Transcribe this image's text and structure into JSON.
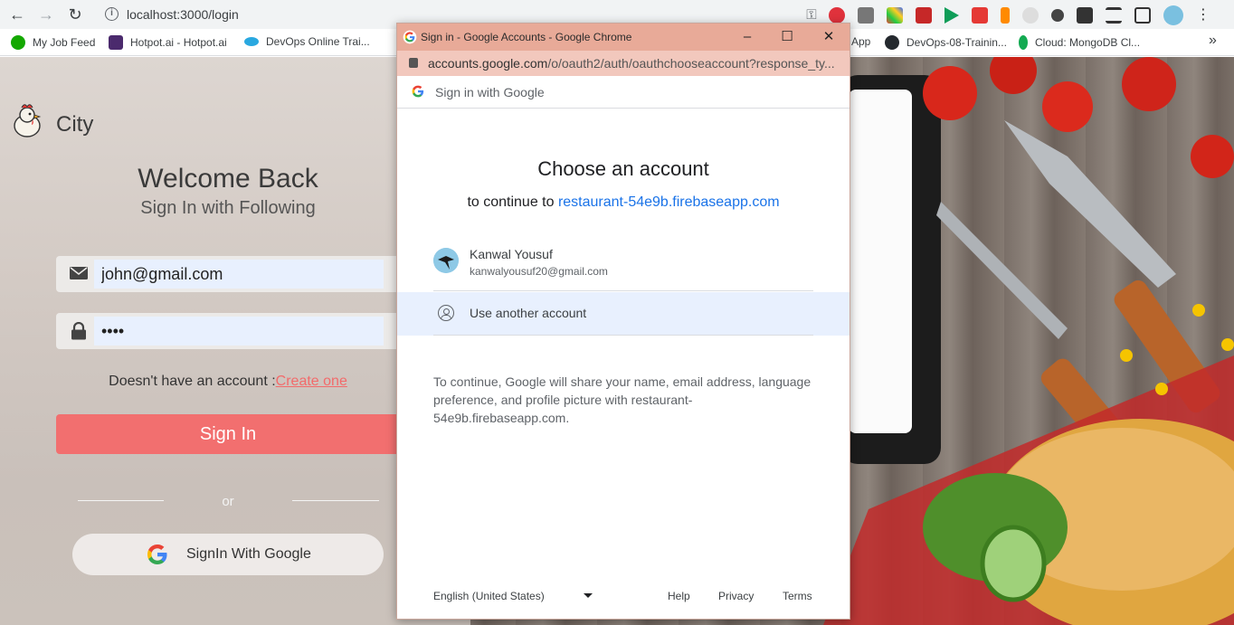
{
  "browser": {
    "url": "localhost:3000/login",
    "bookmarks": [
      {
        "label": "My Job Feed",
        "icon": "upwork-icon",
        "color": "#14a800"
      },
      {
        "label": "Hotpot.ai - Hotpot.ai",
        "icon": "hotpot-icon",
        "color": "#4b2a6d"
      },
      {
        "label": "DevOps Online Trai...",
        "icon": "devops-icon",
        "color": "#29a8e0"
      },
      {
        "label": "App",
        "icon": "",
        "color": ""
      },
      {
        "label": "DevOps-08-Trainin...",
        "icon": "github-icon",
        "color": "#24292e"
      },
      {
        "label": "Cloud: MongoDB Cl...",
        "icon": "mongodb-icon",
        "color": "#13aa52"
      }
    ],
    "extensions": [
      "adblock-icon",
      "eyedropper-icon",
      "color-grid-icon",
      "video-icon",
      "play-icon",
      "pdf-icon",
      "bing-icon",
      "ghost-icon",
      "cookie-icon",
      "puzzle-icon",
      "reading-list-icon",
      "sidepanel-icon",
      "profile-icon",
      "menu-icon"
    ]
  },
  "app": {
    "brand": "City",
    "welcome": "Welcome Back",
    "subheading": "Sign In with Following",
    "email_value": "john@gmail.com",
    "password_value": "••••",
    "signup_prompt": "Doesn't have an account :",
    "signup_link": "Create one",
    "signin_button": "Sign In",
    "or_label": "or",
    "google_button": "SignIn With Google"
  },
  "popup": {
    "window_title": "Sign in - Google Accounts - Google Chrome",
    "url_host": "accounts.google.com",
    "url_path": "/o/oauth2/auth/oauthchooseaccount?response_ty...",
    "header": "Sign in with Google",
    "title": "Choose an account",
    "continue_prefix": "to continue to ",
    "continue_app": "restaurant-54e9b.firebaseapp.com",
    "account": {
      "name": "Kanwal Yousuf",
      "email": "kanwalyousuf20@gmail.com"
    },
    "use_another": "Use another account",
    "notice": "To continue, Google will share your name, email address, language preference, and profile picture with restaurant-54e9b.firebaseapp.com.",
    "footer": {
      "language": "English (United States)",
      "help": "Help",
      "privacy": "Privacy",
      "terms": "Terms"
    }
  },
  "colors": {
    "accent": "#f26f6f",
    "google_blue": "#1a73e8",
    "popup_title": "#e8aa98"
  }
}
